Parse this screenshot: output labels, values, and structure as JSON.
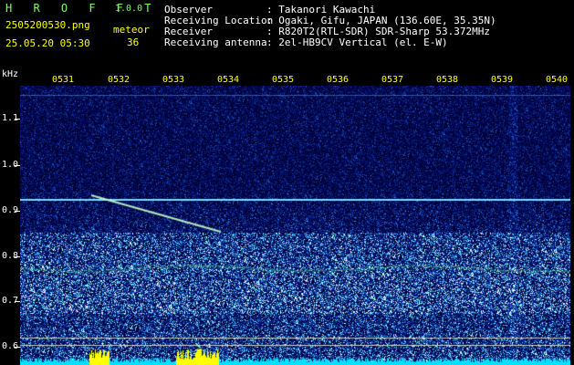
{
  "app": {
    "name": "H R O F F T",
    "version": "1.0.0"
  },
  "file": {
    "name": "2505200530.png",
    "datetime": "25.05.20 05:30"
  },
  "meteor": {
    "label": "meteor",
    "count": "36"
  },
  "info": [
    {
      "key": "Observer",
      "value": ": Takanori Kawachi"
    },
    {
      "key": "Receiving Location",
      "value": ": Ogaki, Gifu, JAPAN (136.60E, 35.35N)"
    },
    {
      "key": "Receiver",
      "value": ": R820T2(RTL-SDR) SDR-Sharp 53.372MHz"
    },
    {
      "key": "Receiving antenna",
      "value": ": 2el-HB9CV Vertical (el. E-W)"
    }
  ],
  "axis": {
    "unit": "kHz",
    "x_ticks": [
      "0531",
      "0532",
      "0533",
      "0534",
      "0535",
      "0536",
      "0537",
      "0538",
      "0539",
      "0540"
    ],
    "y_ticks": [
      "1.1",
      "1.0",
      "0.9",
      "0.8",
      "0.7",
      "0.6"
    ]
  },
  "colors": {
    "background": "#000000",
    "label_yellow": "#ffff00",
    "label_white": "#ffffff",
    "title_green": "#7dff5a",
    "spectrum_low": "#00104a",
    "spectrum_high": "#00e6ff",
    "carrier_line": "#7fd8ff",
    "power_bar": "#00e0ff",
    "power_bar_peak": "#ffff00"
  }
}
